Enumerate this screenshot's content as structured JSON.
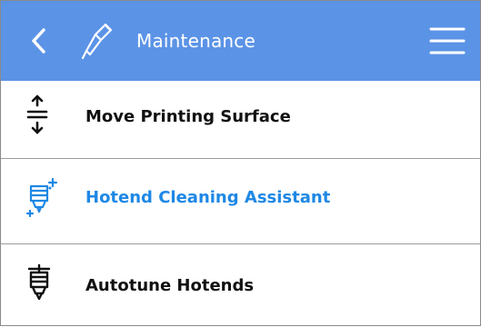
{
  "header": {
    "title": "Maintenance",
    "back_icon": "chevron-left-icon",
    "tool_icon": "screwdriver-icon",
    "menu_icon": "hamburger-menu-icon",
    "background_color": "#5b93e6"
  },
  "items": [
    {
      "label": "Move Printing Surface",
      "icon": "move-surface-icon",
      "selected": false
    },
    {
      "label": "Hotend Cleaning Assistant",
      "icon": "hotend-cleaning-icon",
      "selected": true
    },
    {
      "label": "Autotune Hotends",
      "icon": "hotend-icon",
      "selected": false
    }
  ],
  "colors": {
    "accent": "#1e88e5",
    "text": "#111111",
    "divider": "#9c9c9c"
  }
}
